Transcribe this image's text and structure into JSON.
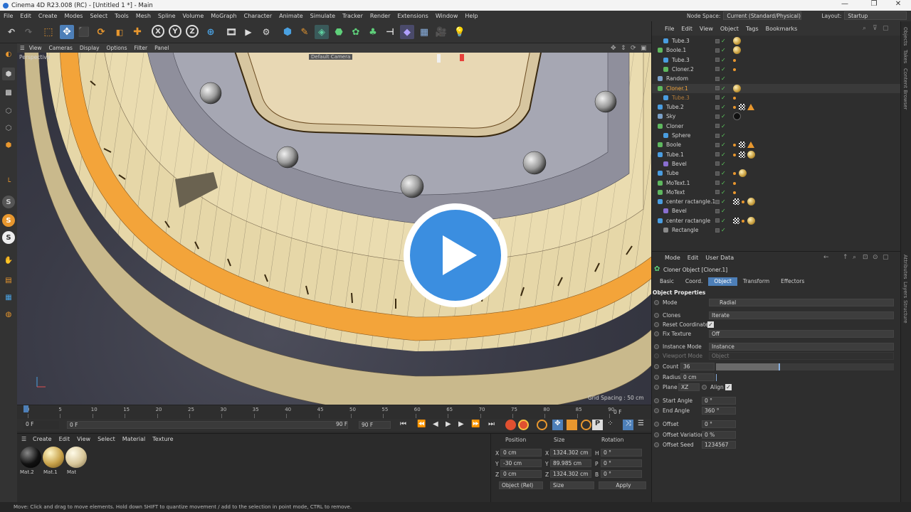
{
  "window": {
    "title": "Cinema 4D R23.008 (RC) - [Untitled 1 *] - Main",
    "controls": [
      "—",
      "❐",
      "✕"
    ]
  },
  "menubar": {
    "items": [
      "File",
      "Edit",
      "Create",
      "Modes",
      "Select",
      "Tools",
      "Mesh",
      "Spline",
      "Volume",
      "MoGraph",
      "Character",
      "Animate",
      "Simulate",
      "Tracker",
      "Render",
      "Extensions",
      "Window",
      "Help"
    ],
    "node_space_label": "Node Space:",
    "node_space_value": "Current (Standard/Physical)",
    "layout_label": "Layout:",
    "layout_value": "Startup"
  },
  "toolbar": {
    "axis_x": "X",
    "axis_y": "Y",
    "axis_z": "Z"
  },
  "viewport": {
    "menu": [
      "View",
      "Cameras",
      "Display",
      "Options",
      "Filter",
      "Panel"
    ],
    "label": "Perspective",
    "camera_label": "Default Camera",
    "grid_spacing": "Grid Spacing : 50 cm"
  },
  "timeline": {
    "ticks": [
      "0",
      "5",
      "10",
      "15",
      "20",
      "25",
      "30",
      "35",
      "40",
      "45",
      "50",
      "55",
      "60",
      "65",
      "70",
      "75",
      "80",
      "85",
      "90"
    ],
    "end_frame_label": "0 F",
    "current_frame": "0 F",
    "min_frame": "0 F",
    "max_frame": "90 F",
    "end_field": "90 F"
  },
  "material_manager": {
    "menu": [
      "Create",
      "Edit",
      "View",
      "Select",
      "Material",
      "Texture"
    ],
    "materials": [
      {
        "name": "Mat.2",
        "color": "#1a1a1a"
      },
      {
        "name": "Mat.1",
        "color": "#c8a24a"
      },
      {
        "name": "Mat",
        "color": "#d8c79a"
      }
    ]
  },
  "coordinates": {
    "headers": [
      "Position",
      "Size",
      "Rotation"
    ],
    "rows": [
      {
        "axis": "X",
        "pos": "0 cm",
        "size_axis": "X",
        "size": "1324.302 cm",
        "rot_axis": "H",
        "rot": "0 °"
      },
      {
        "axis": "Y",
        "pos": "-30 cm",
        "size_axis": "Y",
        "size": "89.985 cm",
        "rot_axis": "P",
        "rot": "0 °"
      },
      {
        "axis": "Z",
        "pos": "0 cm",
        "size_axis": "Z",
        "size": "1324.302 cm",
        "rot_axis": "B",
        "rot": "0 °"
      }
    ],
    "mode": "Object (Rel)",
    "size_mode": "Size",
    "apply": "Apply"
  },
  "object_manager": {
    "menu": [
      "File",
      "Edit",
      "View",
      "Object",
      "Tags",
      "Bookmarks"
    ],
    "objects": [
      {
        "name": "Tube.3",
        "indent": 1,
        "icon": "#4a9de0",
        "tags": [
          "sphere"
        ]
      },
      {
        "name": "Boole.1",
        "indent": 0,
        "icon": "#5fb85f",
        "tags": [
          "sphere"
        ]
      },
      {
        "name": "Tube.3",
        "indent": 1,
        "icon": "#4a9de0",
        "tags": [
          "dot"
        ]
      },
      {
        "name": "Cloner.2",
        "indent": 1,
        "icon": "#5fb85f",
        "tags": [
          "dot"
        ]
      },
      {
        "name": "Random",
        "indent": 0,
        "icon": "#7aa0c8",
        "tags": []
      },
      {
        "name": "Cloner.1",
        "indent": 0,
        "icon": "#5fb85f",
        "tags": [
          "sphere"
        ],
        "highlight": true
      },
      {
        "name": "Tube.3",
        "indent": 1,
        "icon": "#4a9de0",
        "tags": [
          "dot"
        ],
        "dim": true
      },
      {
        "name": "Tube.2",
        "indent": 0,
        "icon": "#4a9de0",
        "tags": [
          "dot",
          "checker",
          "tri"
        ]
      },
      {
        "name": "Sky",
        "indent": 0,
        "icon": "#7aa0c8",
        "tags": [
          "dark"
        ]
      },
      {
        "name": "Cloner",
        "indent": 0,
        "icon": "#5fb85f",
        "tags": []
      },
      {
        "name": "Sphere",
        "indent": 1,
        "icon": "#4a9de0",
        "tags": []
      },
      {
        "name": "Boole",
        "indent": 0,
        "icon": "#5fb85f",
        "tags": [
          "dot",
          "checker",
          "tri"
        ]
      },
      {
        "name": "Tube.1",
        "indent": 0,
        "icon": "#4a9de0",
        "tags": [
          "dot",
          "checker",
          "sphere"
        ]
      },
      {
        "name": "Bevel",
        "indent": 1,
        "icon": "#8a6fd0",
        "tags": []
      },
      {
        "name": "Tube",
        "indent": 0,
        "icon": "#4a9de0",
        "tags": [
          "dot",
          "sphere"
        ]
      },
      {
        "name": "MoText.1",
        "indent": 0,
        "icon": "#5fb85f",
        "tags": [
          "dot"
        ]
      },
      {
        "name": "MoText",
        "indent": 0,
        "icon": "#5fb85f",
        "tags": [
          "dot"
        ]
      },
      {
        "name": "center ractangle.1",
        "indent": 0,
        "icon": "#4a9de0",
        "tags": [
          "checker",
          "dot",
          "sphere"
        ]
      },
      {
        "name": "Bevel",
        "indent": 1,
        "icon": "#8a6fd0",
        "tags": []
      },
      {
        "name": "center ractangle",
        "indent": 0,
        "icon": "#4a9de0",
        "tags": [
          "checker",
          "dot",
          "sphere"
        ]
      },
      {
        "name": "Rectangle",
        "indent": 1,
        "icon": "#8a8a8a",
        "tags": []
      }
    ]
  },
  "attribute_manager": {
    "menu": [
      "Mode",
      "Edit",
      "User Data"
    ],
    "object_title": "Cloner Object [Cloner.1]",
    "tabs": [
      "Basic",
      "Coord.",
      "Object",
      "Transform",
      "Effectors"
    ],
    "active_tab": "Object",
    "section": "Object Properties",
    "fields": {
      "mode_label": "Mode",
      "mode_value": "Radial",
      "clones_label": "Clones",
      "clones_value": "Iterate",
      "reset_coords_label": "Reset Coordinates",
      "fix_texture_label": "Fix Texture",
      "fix_texture_value": "Off",
      "instance_mode_label": "Instance Mode",
      "instance_mode_value": "Instance",
      "viewport_mode_label": "Viewport Mode",
      "viewport_mode_value": "Object",
      "count_label": "Count",
      "count_value": "36",
      "count_fraction": 0.36,
      "radius_label": "Radius",
      "radius_value": "0 cm",
      "plane_label": "Plane",
      "plane_value": "XZ",
      "align_label": "Align",
      "start_angle_label": "Start Angle",
      "start_angle_value": "0 °",
      "end_angle_label": "End Angle",
      "end_angle_value": "360 °",
      "offset_label": "Offset",
      "offset_value": "0 °",
      "offset_variation_label": "Offset Variation",
      "offset_variation_value": "0 %",
      "offset_seed_label": "Offset Seed",
      "offset_seed_value": "1234567"
    }
  },
  "right_strip": [
    "Objects",
    "Takes",
    "Content Browser",
    "Attributes",
    "Layers",
    "Structure"
  ],
  "status": "Move: Click and drag to move elements. Hold down SHIFT to quantize movement / add to the selection in point mode, CTRL to remove.",
  "colors": {
    "accent": "#4d7fb8",
    "highlight_orange": "#f39c2e",
    "play_blue": "#3b8ee0"
  }
}
